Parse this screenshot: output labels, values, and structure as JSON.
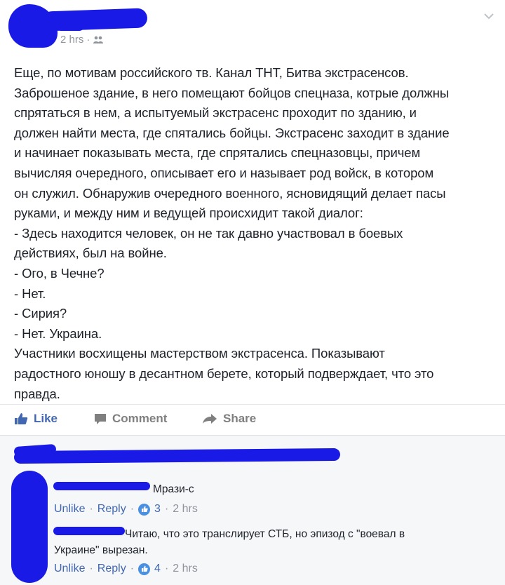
{
  "post": {
    "timestamp": "2 hrs",
    "privacy_icon": "friends-icon",
    "lines": [
      "Еще, по мотивам российского тв. Канал ТНТ, Битва экстрасенсов.",
      "Заброшеное здание, в него помещают бойцов спецназа, котрые должны",
      "спрятаться в нем, а испытуемый экстрасенс проходит по зданию, и",
      "должен найти места, где спятались бойцы. Экстрасенс заходит в здание",
      "и начинает показывать места, где спрятались спецназовцы, причем",
      "вычисляя очередного, описывает его и называет род войск, в котором",
      "он служил. Обнаружив очередного военного, ясновидящий делает пасы",
      "руками, и между ним и ведущей происхидит такой диалог:",
      "- Здесь находится человек, он не так давно участвовал в боевых",
      "действиях, был на войне.",
      "- Ого, в Чечне?",
      "- Нет.",
      "- Сирия?",
      "- Нет. Украина.",
      "Участники восхищены мастерством экстрасенса. Показывают",
      "радостного юношу в десантном берете, который подверждает, что это",
      "правда."
    ]
  },
  "actions": {
    "like": "Like",
    "comment": "Comment",
    "share": "Share"
  },
  "comments": [
    {
      "text": "Мрази-с",
      "unlike": "Unlike",
      "reply": "Reply",
      "likes": "3",
      "time": "2 hrs"
    },
    {
      "text_line1": "Читаю, что это транслирует СТБ, но эпизод с \"воевал в",
      "text_line2": "Украине\" вырезан.",
      "unlike": "Unlike",
      "reply": "Reply",
      "likes": "4",
      "time": "2 hrs"
    }
  ],
  "colors": {
    "accent": "#4267b2",
    "scribble": "#1a1ae6",
    "muted": "#90949c"
  }
}
